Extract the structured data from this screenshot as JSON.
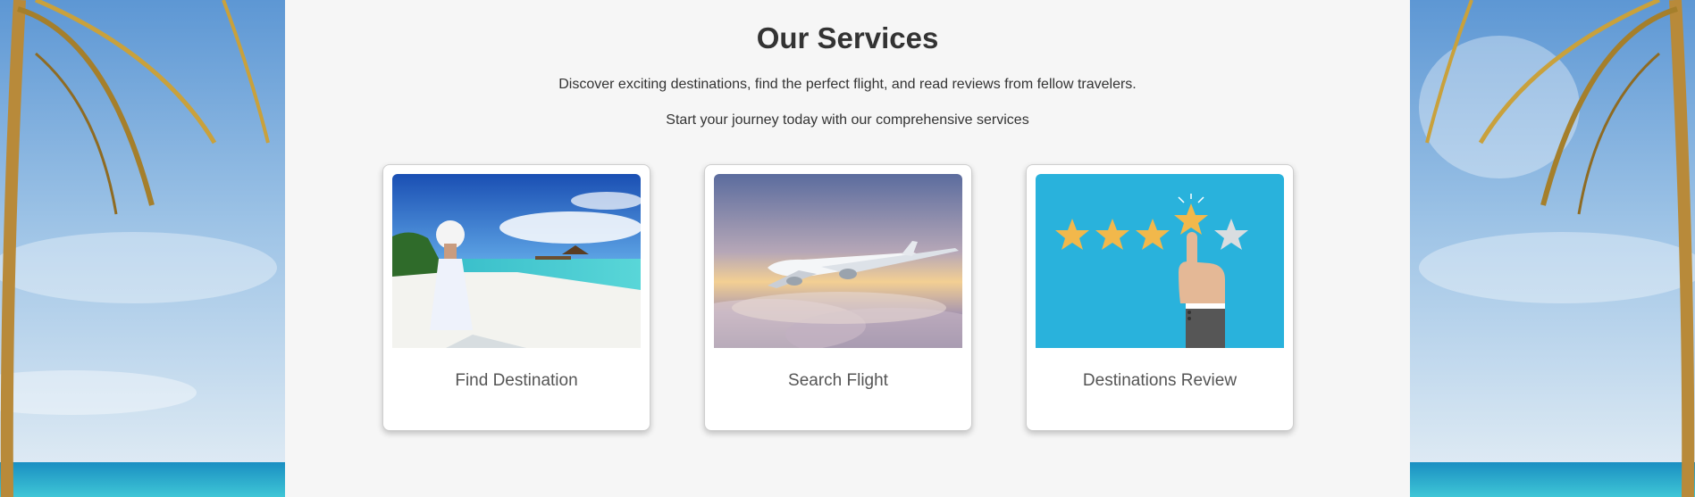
{
  "page": {
    "title": "Our Services",
    "subtitle_1": "Discover exciting destinations, find the perfect flight, and read reviews from fellow travelers.",
    "subtitle_2": "Start your journey today with our comprehensive services"
  },
  "services": [
    {
      "label": "Find Destination",
      "icon": "beach-photo"
    },
    {
      "label": "Search Flight",
      "icon": "airplane-photo"
    },
    {
      "label": "Destinations Review",
      "icon": "star-rating-illustration"
    }
  ],
  "colors": {
    "background": "#f6f6f6",
    "title": "#333333",
    "card_label": "#555555",
    "review_bg": "#29b2dc",
    "star": "#f2b84b"
  }
}
